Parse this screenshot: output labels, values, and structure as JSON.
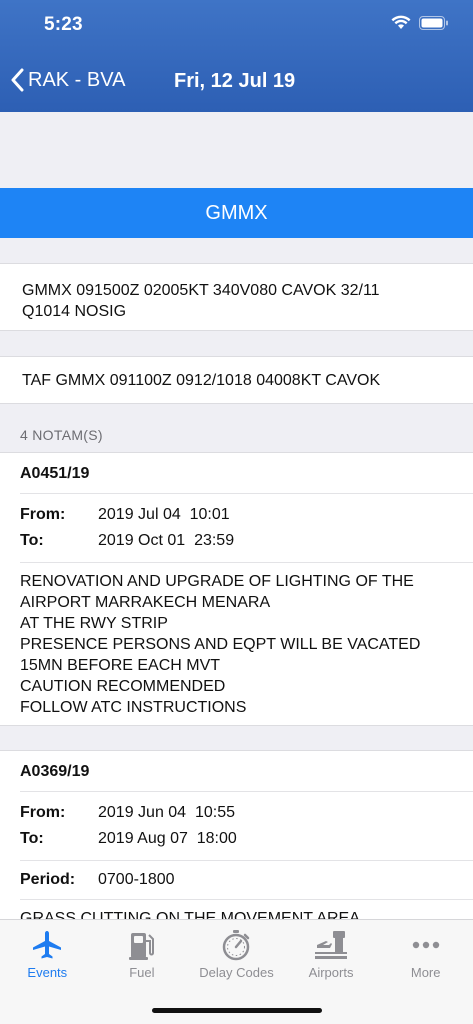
{
  "status": {
    "time": "5:23"
  },
  "nav": {
    "back_label": "RAK - BVA",
    "title": "Fri, 12 Jul 19"
  },
  "station": "GMMX",
  "metar": {
    "line1": "GMMX 091500Z 02005KT 340V080 CAVOK 32/11",
    "line2": "Q1014 NOSIG"
  },
  "taf": "TAF GMMX 091100Z 0912/1018 04008KT CAVOK",
  "notam_count": "4 NOTAM(S)",
  "notams": [
    {
      "id": "A0451/19",
      "from_label": "From:",
      "from": "2019 Jul 04  10:01",
      "to_label": "To:",
      "to": "2019 Oct 01  23:59",
      "text": [
        "RENOVATION AND UPGRADE OF LIGHTING OF THE",
        "AIRPORT MARRAKECH MENARA",
        "AT THE RWY STRIP",
        "PRESENCE PERSONS AND EQPT WILL BE VACATED",
        "15MN BEFORE EACH MVT",
        "CAUTION RECOMMENDED",
        "FOLLOW ATC INSTRUCTIONS"
      ]
    },
    {
      "id": "A0369/19",
      "from_label": "From:",
      "from": "2019 Jun 04  10:55",
      "to_label": "To:",
      "to": "2019 Aug 07  18:00",
      "period_label": "Period:",
      "period": "0700-1800",
      "text": [
        "GRASS CUTTING ON THE MOVEMENT AREA."
      ]
    }
  ],
  "tabs": [
    {
      "label": "Events",
      "icon": "plane-icon"
    },
    {
      "label": "Fuel",
      "icon": "fuel-pump-icon"
    },
    {
      "label": "Delay Codes",
      "icon": "stopwatch-icon"
    },
    {
      "label": "Airports",
      "icon": "control-tower-icon"
    },
    {
      "label": "More",
      "icon": "more-dots-icon"
    }
  ],
  "colors": {
    "header": "#2d5fb4",
    "accent": "#1e84f5",
    "tab_active": "#1e7cf0",
    "tab_inactive": "#8e8e93"
  }
}
